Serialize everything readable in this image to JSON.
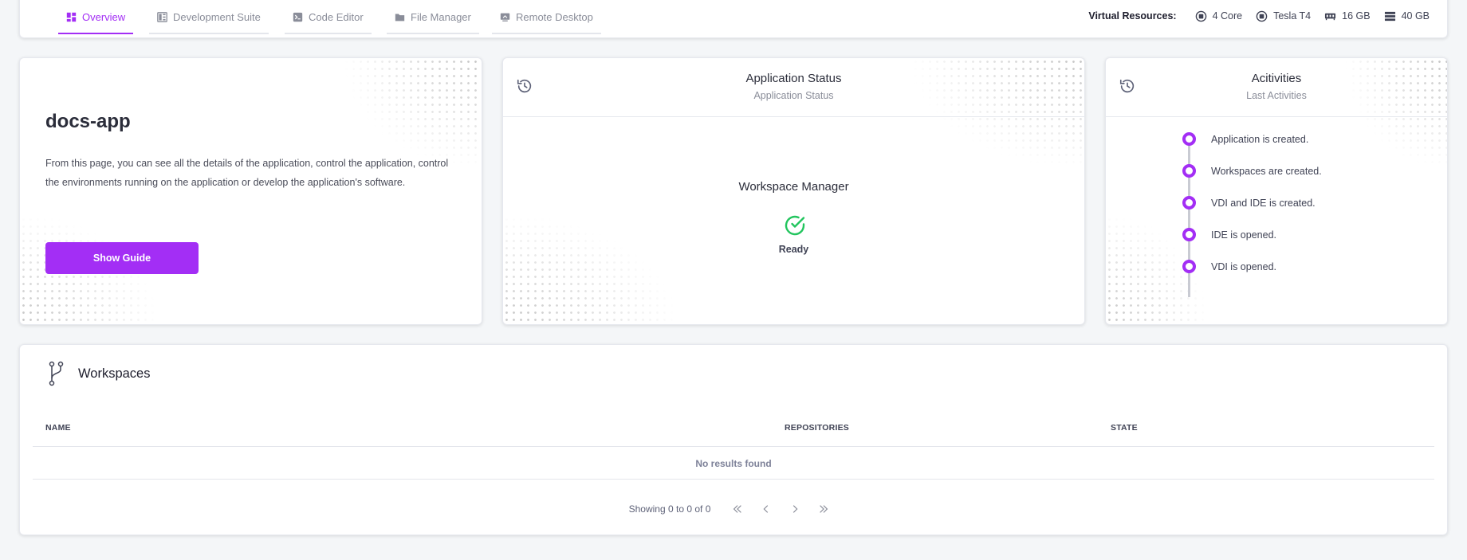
{
  "nav": {
    "tabs": [
      {
        "label": "Overview",
        "icon": "dashboard-icon",
        "active": true
      },
      {
        "label": "Development Suite",
        "icon": "suite-icon",
        "active": false
      },
      {
        "label": "Code Editor",
        "icon": "terminal-icon",
        "active": false
      },
      {
        "label": "File Manager",
        "icon": "folder-icon",
        "active": false
      },
      {
        "label": "Remote Desktop",
        "icon": "desktop-icon",
        "active": false
      }
    ],
    "resources": {
      "title": "Virtual Resources:",
      "cpu": "4 Core",
      "gpu": "Tesla T4",
      "memory": "16 GB",
      "storage": "40 GB"
    }
  },
  "app": {
    "name": "docs-app",
    "description": "From this page, you can see all the details of the application, control the application, control the environments running on the application or develop the application's software.",
    "guide_button": "Show Guide"
  },
  "status": {
    "title": "Application Status",
    "subtitle": "Application Status",
    "component": "Workspace Manager",
    "state": "Ready"
  },
  "activities": {
    "title": "Acitivities",
    "subtitle": "Last Activities",
    "items": [
      "Application is created.",
      "Workspaces are created.",
      "VDI and IDE is created.",
      "IDE is opened.",
      "VDI is opened."
    ]
  },
  "workspaces": {
    "title": "Workspaces",
    "columns": [
      "NAME",
      "REPOSITORIES",
      "STATE"
    ],
    "empty_text": "No results found",
    "pagination": "Showing 0 to 0 of 0"
  },
  "colors": {
    "accent": "#a32ef5",
    "success": "#22c55e"
  }
}
